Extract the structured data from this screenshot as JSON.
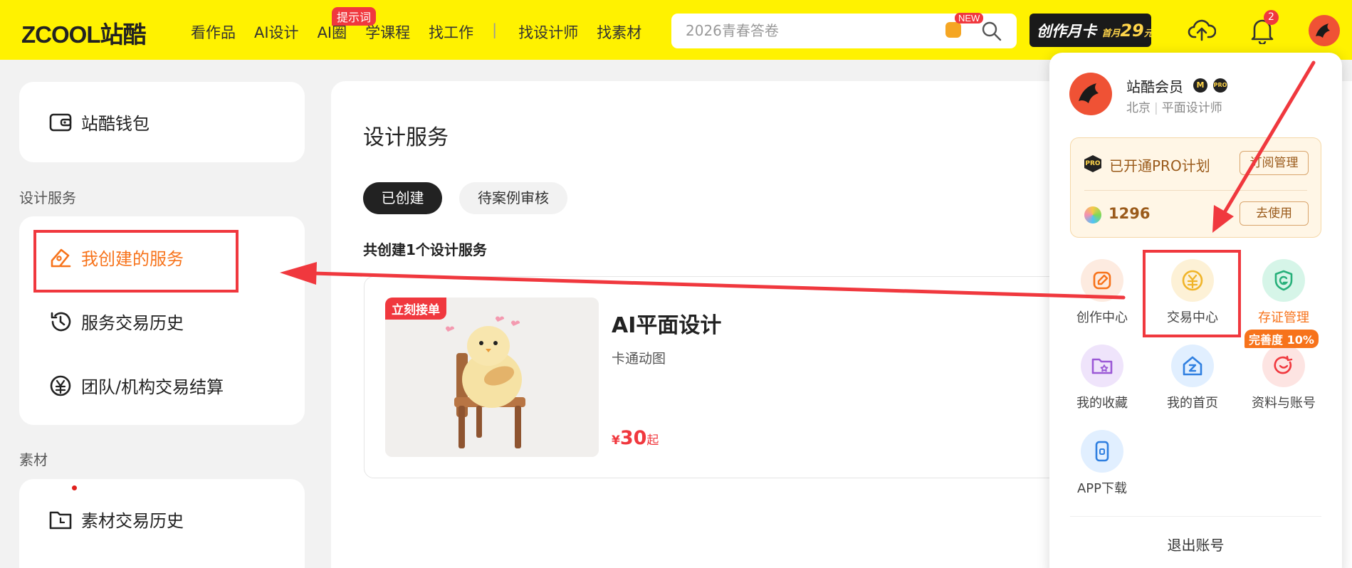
{
  "header": {
    "logo": "ZCOOL站酷",
    "nav": [
      "看作品",
      "AI设计",
      "AI圈",
      "学课程",
      "找工作",
      "找设计师",
      "找素材"
    ],
    "nav_badge": "提示词",
    "search_placeholder": "2026青春答卷",
    "search_new_badge": "NEW",
    "promo_text": "创作月卡",
    "promo_small": "首月",
    "promo_price": "29",
    "promo_unit": "元",
    "notification_count": "2"
  },
  "sidebar": {
    "wallet": "站酷钱包",
    "section_design": "设计服务",
    "design_items": [
      "我创建的服务",
      "服务交易历史",
      "团队/机构交易结算"
    ],
    "section_material": "素材",
    "material_items": [
      "素材交易历史"
    ]
  },
  "main": {
    "title": "设计服务",
    "tabs": [
      "已创建",
      "待案例审核"
    ],
    "count_text": "共创建1个设计服务",
    "service": {
      "ribbon": "立刻接单",
      "title": "AI平面设计",
      "subtitle": "卡通动图",
      "price_currency": "¥",
      "price_value": "30",
      "price_suffix": "起"
    }
  },
  "dropdown": {
    "name": "站酷会员",
    "badge_m": "M",
    "badge_pro": "PRO",
    "location": "北京",
    "role": "平面设计师",
    "pro_icon": "PRO",
    "pro_text": "已开通PRO计划",
    "pro_manage": "订阅管理",
    "coins": "1296",
    "use_button": "去使用",
    "grid": [
      "创作中心",
      "交易中心",
      "存证管理",
      "我的收藏",
      "我的首页",
      "资料与账号",
      "APP下载"
    ],
    "completion_badge": "完善度 10%",
    "logout": "退出账号"
  },
  "colors": {
    "header_bg": "#fff200",
    "accent_orange": "#f7731b",
    "annotation_red": "#f0383e"
  }
}
